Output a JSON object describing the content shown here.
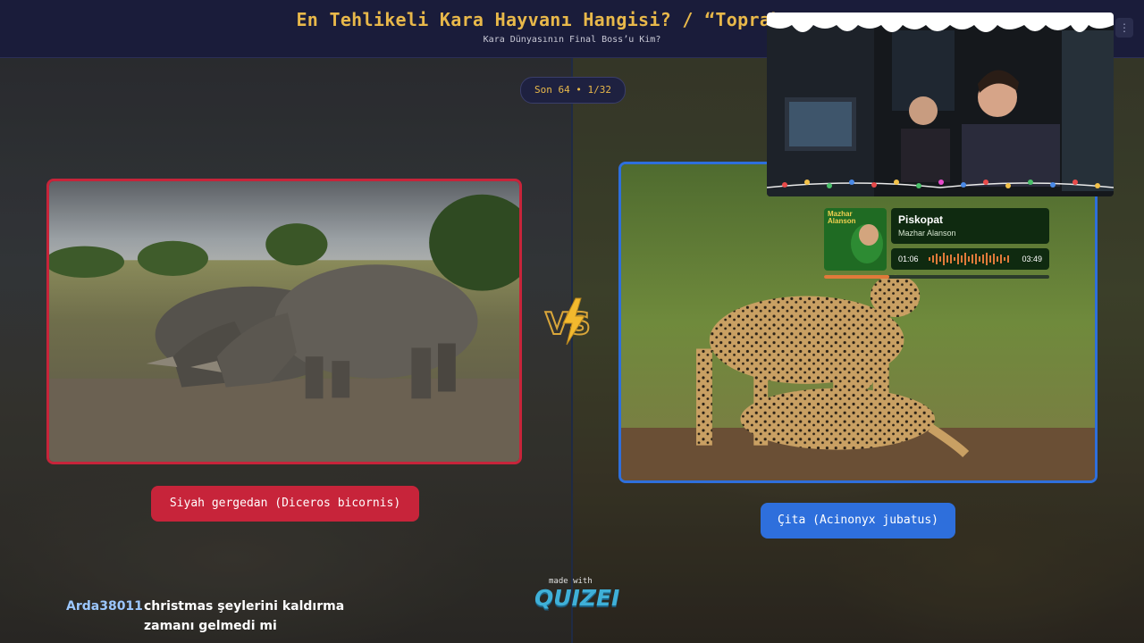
{
  "header": {
    "title": "En Tehlikeli Kara Hayvanı Hangisi? / “Toprak Arena",
    "subtitle": "Kara Dünyasının Final Boss’u Kim?"
  },
  "round": {
    "label": "Son 64 • 1/32"
  },
  "left_option": {
    "label": "Siyah gergedan (Diceros bicornis)",
    "color": "#c7243a"
  },
  "right_option": {
    "label": "Çita (Acinonyx jubatus)",
    "color": "#2e6fdc"
  },
  "vs_icon": "vs-lightning-icon",
  "music": {
    "album_text": "Mazhar Alanson",
    "title": "Piskopat",
    "artist": "Mazhar Alanson",
    "elapsed": "01:06",
    "duration": "03:49",
    "progress": 0.29
  },
  "branding": {
    "made_with": "made with",
    "logo": "QUIZEI"
  },
  "chat": {
    "username": "Arda38011",
    "message": "christmas şeylerini kaldırma zamanı gelmedi mi"
  }
}
